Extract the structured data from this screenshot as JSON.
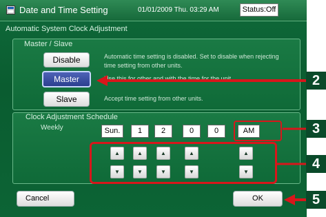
{
  "titlebar": {
    "title": "Date and Time Setting",
    "datetime": "01/01/2009 Thu. 03:29 AM",
    "status": "Status:Off"
  },
  "section_title": "Automatic System Clock Adjustment",
  "master_slave": {
    "title": "Master / Slave",
    "options": [
      {
        "label": "Disable",
        "description": "Automatic time setting is disabled. Set to disable when rejecting time setting from other units.",
        "selected": false
      },
      {
        "label": "Master",
        "description": "Use this for other and with the time for the unit.",
        "selected": true
      },
      {
        "label": "Slave",
        "description": "Accept time setting from other units.",
        "selected": false
      }
    ]
  },
  "schedule": {
    "title": "Clock Adjustment Schedule",
    "frequency": "Weekly",
    "fields": [
      "Sun.",
      "1",
      "2",
      "0",
      "0",
      "AM"
    ],
    "up_arrow": "▲",
    "down_arrow": "▼"
  },
  "footer": {
    "cancel_label": "Cancel",
    "ok_label": "OK"
  },
  "callouts": [
    "2",
    "3",
    "4",
    "5"
  ],
  "colors": {
    "accent_red": "#d8161b",
    "selected_blue": "#3a4fa3",
    "background_green": "#0f6a3a"
  },
  "icons": {
    "app": "app-window-icon"
  }
}
